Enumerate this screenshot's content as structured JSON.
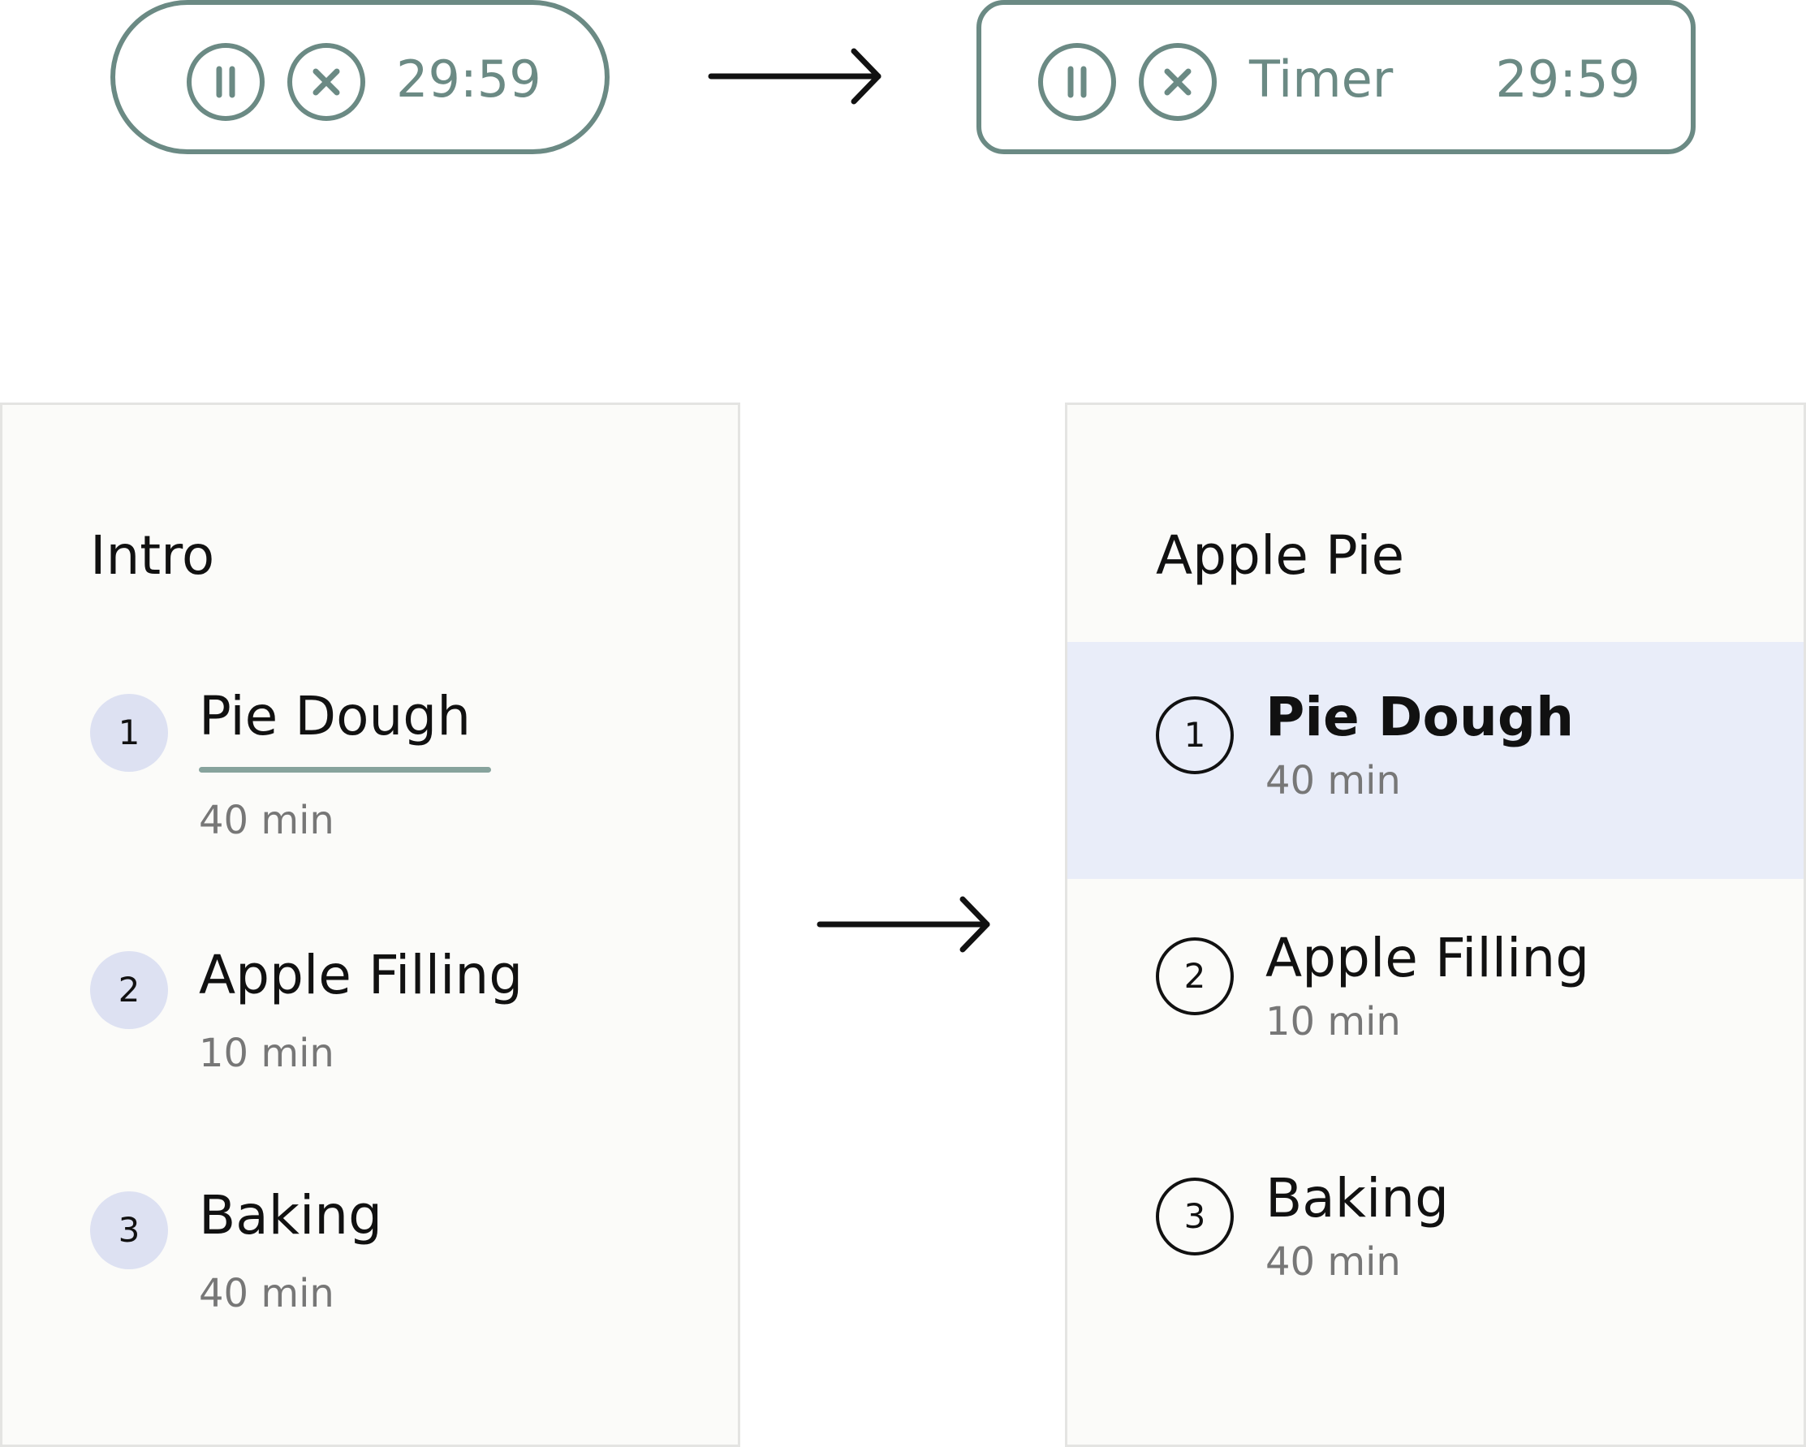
{
  "colors": {
    "timer_accent": "#6b8a84",
    "step_badge_fill": "#dde1f2",
    "active_row_bg": "#e9edf9",
    "underline": "#87a39d",
    "panel_bg": "#fbfbf9"
  },
  "timer_before": {
    "time": "29:59",
    "pause_icon": "pause-icon",
    "stop_icon": "close-icon"
  },
  "timer_after": {
    "label": "Timer",
    "time": "29:59",
    "pause_icon": "pause-icon",
    "stop_icon": "close-icon"
  },
  "panel_before": {
    "title": "Intro",
    "steps": [
      {
        "num": "1",
        "name": "Pie Dough",
        "duration": "40 min"
      },
      {
        "num": "2",
        "name": "Apple Filling",
        "duration": "10 min"
      },
      {
        "num": "3",
        "name": "Baking",
        "duration": "40 min"
      }
    ]
  },
  "panel_after": {
    "title": "Apple Pie",
    "steps": [
      {
        "num": "1",
        "name": "Pie Dough",
        "duration": "40 min"
      },
      {
        "num": "2",
        "name": "Apple Filling",
        "duration": "10 min"
      },
      {
        "num": "3",
        "name": "Baking",
        "duration": "40 min"
      }
    ]
  }
}
